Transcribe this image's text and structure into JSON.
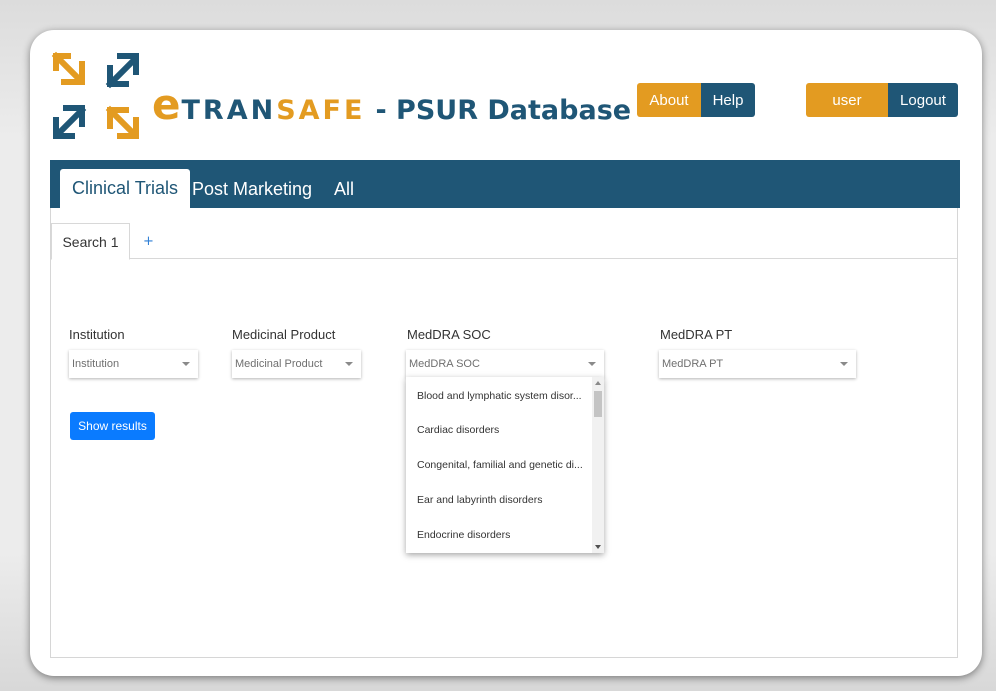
{
  "brand": {
    "e": "e",
    "tran": "TRAN",
    "safe": "SAFE",
    "title": "- PSUR Database"
  },
  "header": {
    "about_label": "About",
    "help_label": "Help",
    "user_label": "user",
    "logout_label": "Logout"
  },
  "nav": {
    "tabs": [
      {
        "label": "Clinical Trials",
        "active": true
      },
      {
        "label": "Post Marketing"
      },
      {
        "label": "All"
      }
    ]
  },
  "search_tabs": {
    "active_label": "Search 1",
    "add_label": "+"
  },
  "filters": {
    "institution": {
      "label": "Institution",
      "placeholder": "Institution"
    },
    "product": {
      "label": "Medicinal Product",
      "placeholder": "Medicinal Product"
    },
    "soc": {
      "label": "MedDRA SOC",
      "placeholder": "MedDRA SOC"
    },
    "pt": {
      "label": "MedDRA PT",
      "placeholder": "MedDRA PT"
    }
  },
  "soc_dropdown": {
    "options": [
      "Blood and lymphatic system disor...",
      "Cardiac disorders",
      "Congenital, familial and genetic di...",
      "Ear and labyrinth disorders",
      "Endocrine disorders"
    ]
  },
  "actions": {
    "show_results_label": "Show results"
  },
  "colors": {
    "brand_blue": "#1f5676",
    "brand_orange": "#e39b21",
    "primary_button": "#0a7bff"
  }
}
